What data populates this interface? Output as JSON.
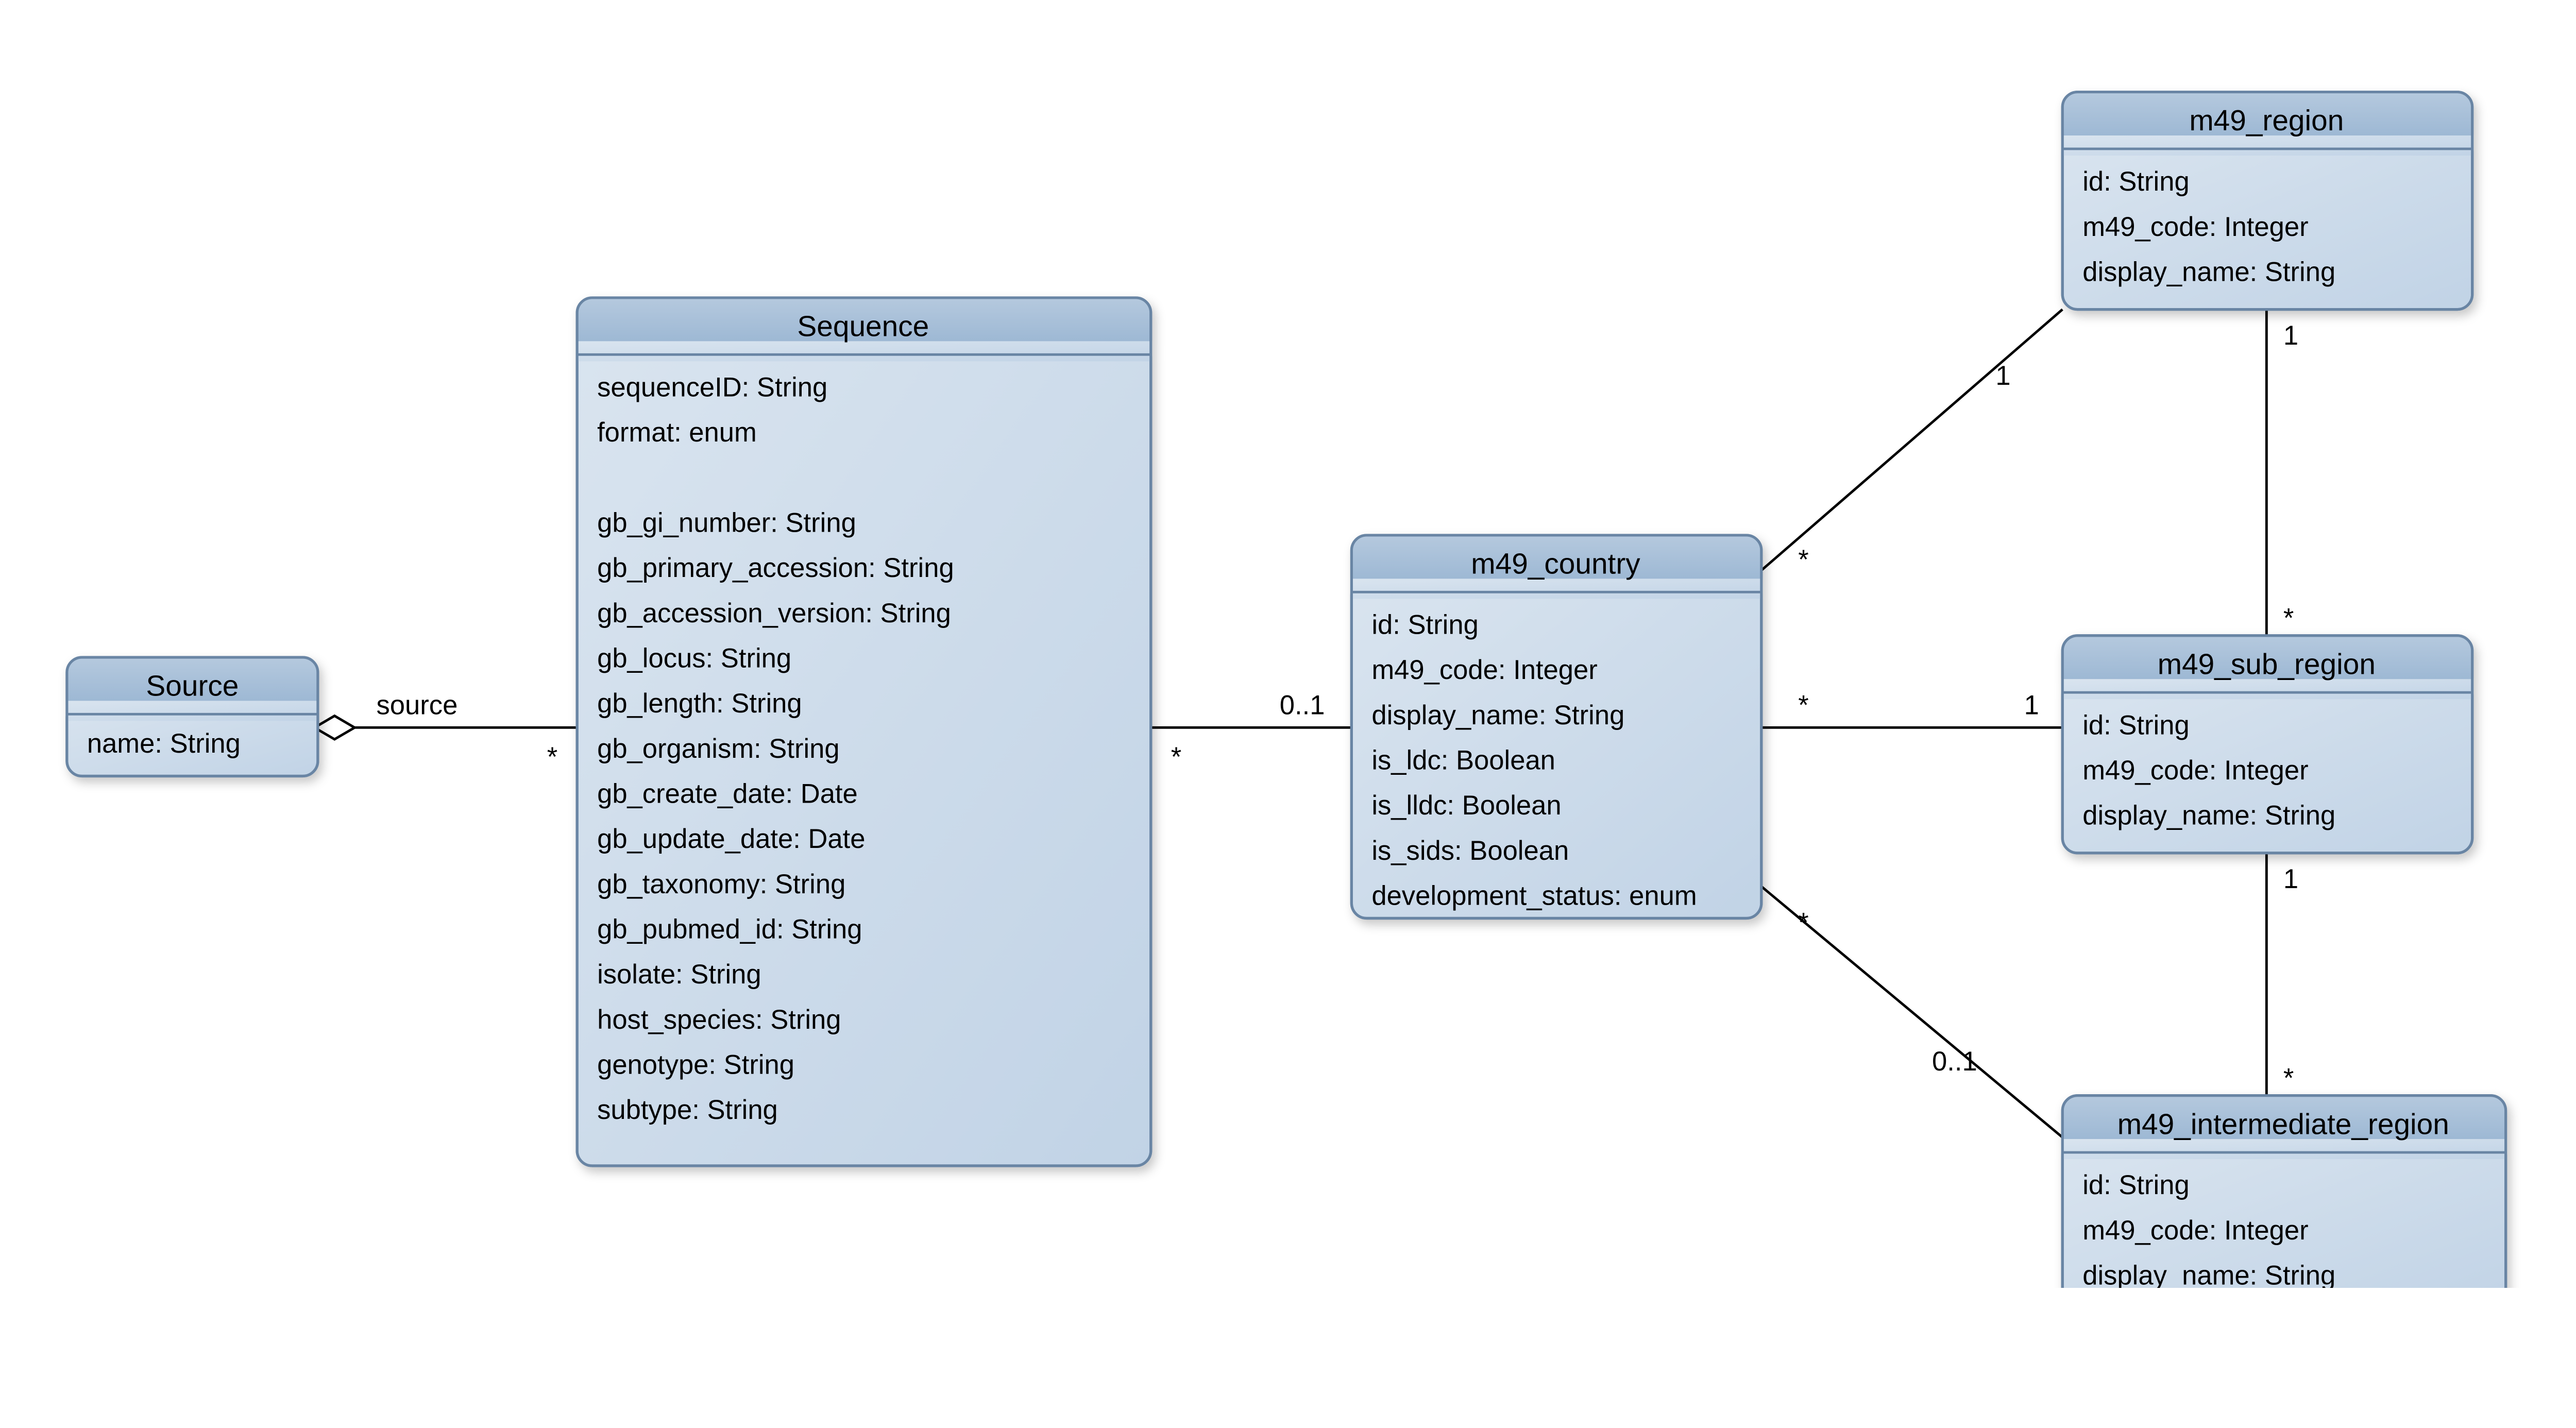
{
  "classes": {
    "source": {
      "name": "Source",
      "attrs": [
        "name: String"
      ]
    },
    "sequence": {
      "name": "Sequence",
      "attrs": [
        "sequenceID: String",
        "format: enum",
        "",
        "gb_gi_number: String",
        "gb_primary_accession: String",
        "gb_accession_version: String",
        "gb_locus: String",
        "gb_length: String",
        "gb_organism: String",
        "gb_create_date: Date",
        "gb_update_date: Date",
        "gb_taxonomy: String",
        "gb_pubmed_id: String",
        "isolate: String",
        "host_species: String",
        "genotype: String",
        "subtype: String"
      ]
    },
    "country": {
      "name": "m49_country",
      "attrs": [
        "id: String",
        "m49_code: Integer",
        "display_name: String",
        "is_ldc: Boolean",
        "is_lldc: Boolean",
        "is_sids: Boolean",
        "development_status: enum"
      ]
    },
    "region": {
      "name": "m49_region",
      "attrs": [
        "id: String",
        "m49_code: Integer",
        "display_name: String"
      ]
    },
    "subregion": {
      "name": "m49_sub_region",
      "attrs": [
        "id: String",
        "m49_code: Integer",
        "display_name: String"
      ]
    },
    "intregion": {
      "name": "m49_intermediate_region",
      "attrs": [
        "id: String",
        "m49_code: Integer",
        "display_name: String"
      ]
    }
  },
  "assoc": {
    "source_sequence": {
      "role_label": "source",
      "mult_left": "",
      "mult_right": "*"
    },
    "sequence_country": {
      "mult_left": "*",
      "mult_right": "0..1"
    },
    "country_region": {
      "mult_left": "*",
      "mult_right": "1"
    },
    "country_subregion": {
      "mult_left": "*",
      "mult_right": "1"
    },
    "country_intregion": {
      "mult_left": "*",
      "mult_right": "0..1"
    },
    "region_subregion": {
      "mult_top": "1",
      "mult_bottom": "*"
    },
    "subregion_intregion": {
      "mult_top": "1",
      "mult_bottom": "*"
    }
  }
}
